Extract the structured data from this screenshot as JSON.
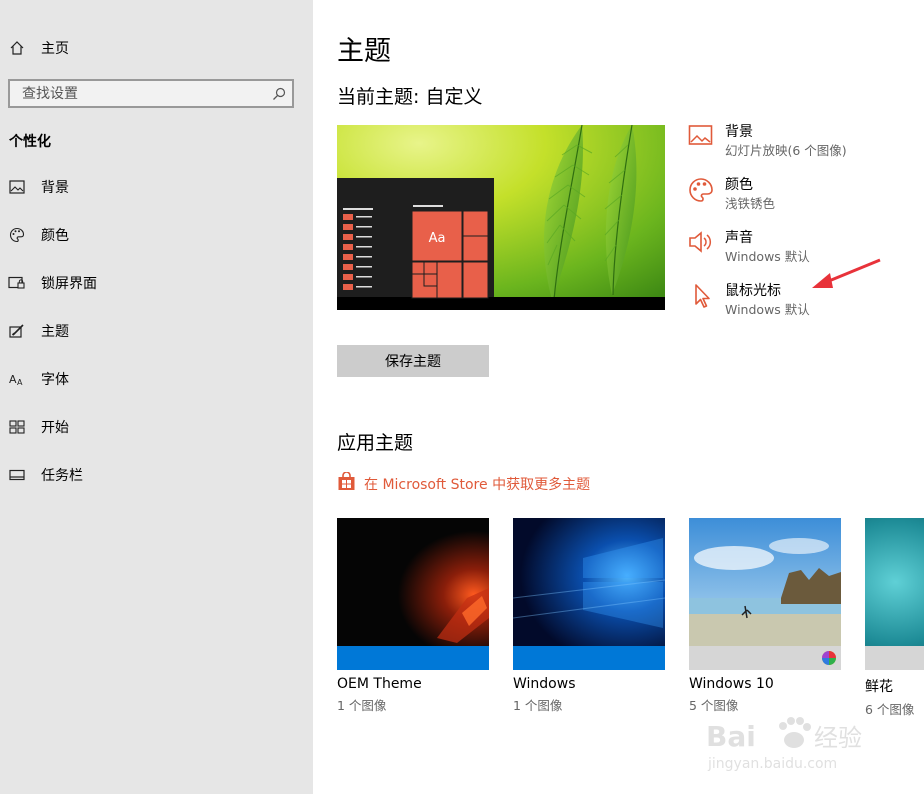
{
  "sidebar": {
    "home": "主页",
    "search_placeholder": "查找设置",
    "section": "个性化",
    "items": [
      {
        "label": "背景",
        "icon": "picture-icon"
      },
      {
        "label": "颜色",
        "icon": "palette-icon"
      },
      {
        "label": "锁屏界面",
        "icon": "lock-screen-icon"
      },
      {
        "label": "主题",
        "icon": "theme-brush-icon"
      },
      {
        "label": "字体",
        "icon": "font-icon"
      },
      {
        "label": "开始",
        "icon": "start-tiles-icon"
      },
      {
        "label": "任务栏",
        "icon": "taskbar-icon"
      }
    ]
  },
  "main": {
    "title": "主题",
    "current_theme": "当前主题: 自定义",
    "preview": {
      "tile_text": "Aa"
    },
    "properties": [
      {
        "title": "背景",
        "sub": "幻灯片放映(6 个图像)",
        "icon": "picture-icon"
      },
      {
        "title": "颜色",
        "sub": "浅铁锈色",
        "icon": "palette-icon"
      },
      {
        "title": "声音",
        "sub": "Windows 默认",
        "icon": "speaker-icon"
      },
      {
        "title": "鼠标光标",
        "sub": "Windows 默认",
        "icon": "cursor-icon"
      }
    ],
    "save_button": "保存主题",
    "apply_title": "应用主题",
    "store_link": "在 Microsoft Store 中获取更多主题",
    "themes": [
      {
        "name": "OEM Theme",
        "count": "1 个图像"
      },
      {
        "name": "Windows",
        "count": "1 个图像"
      },
      {
        "name": "Windows 10",
        "count": "5 个图像"
      },
      {
        "name": "鲜花",
        "count": "6 个图像"
      }
    ]
  },
  "watermark": {
    "brand": "Bai",
    "brand2": "经验",
    "url": "jingyan.baidu.com"
  },
  "colors": {
    "accent": "#e05a3a",
    "sidebar_bg": "#e6e6e6",
    "win_blue": "#0078d7"
  }
}
